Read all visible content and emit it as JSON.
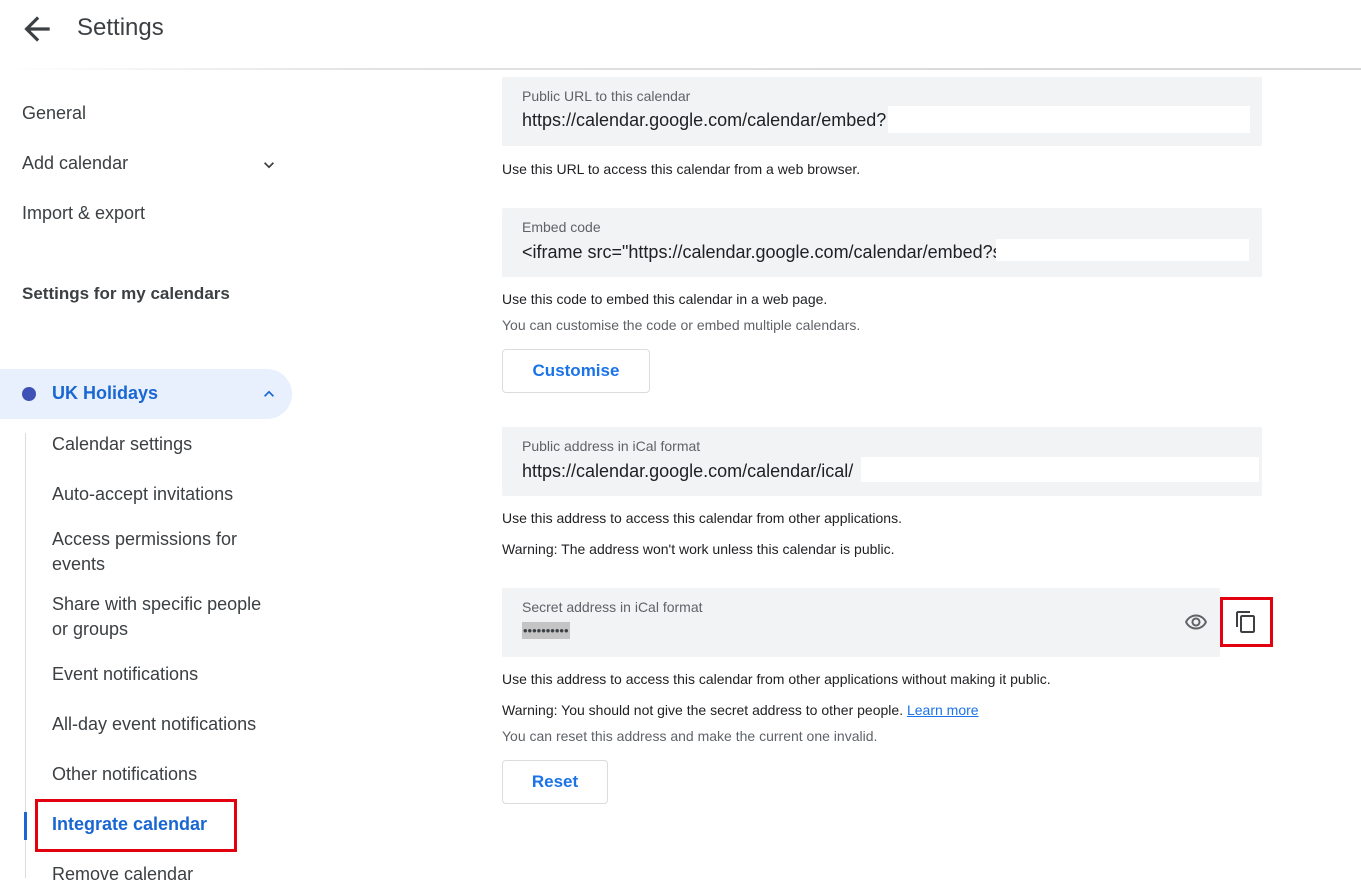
{
  "header": {
    "title": "Settings",
    "back_icon": "arrow-back-icon"
  },
  "sidebar": {
    "items": [
      {
        "label": "General"
      },
      {
        "label": "Add calendar"
      },
      {
        "label": "Import & export"
      }
    ],
    "section_title": "Settings for my calendars",
    "calendar": {
      "name": "UK Holidays",
      "color": "#3f51b5",
      "sub_items": [
        {
          "label": "Calendar settings"
        },
        {
          "label": "Auto-accept invitations"
        },
        {
          "label": "Access permissions for events"
        },
        {
          "label": "Share with specific people or groups"
        },
        {
          "label": "Event notifications"
        },
        {
          "label": "All-day event notifications"
        },
        {
          "label": "Other notifications"
        },
        {
          "label": "Integrate calendar"
        },
        {
          "label": "Remove calendar"
        }
      ]
    }
  },
  "main": {
    "public_url": {
      "label": "Public URL to this calendar",
      "value": "https://calendar.google.com/calendar/embed?",
      "helper": "Use this URL to access this calendar from a web browser."
    },
    "embed_code": {
      "label": "Embed code",
      "value": "<iframe src=\"https://calendar.google.com/calendar/embed?s",
      "helper": "Use this code to embed this calendar in a web page.",
      "helper2": "You can customise the code or embed multiple calendars.",
      "button": "Customise"
    },
    "ical_public": {
      "label": "Public address in iCal format",
      "value": "https://calendar.google.com/calendar/ical/",
      "helper": "Use this address to access this calendar from other applications.",
      "warning": "Warning: The address won't work unless this calendar is public."
    },
    "ical_secret": {
      "label": "Secret address in iCal format",
      "value": "••••••••••",
      "helper": "Use this address to access this calendar from other applications without making it public.",
      "warning": "Warning: You should not give the secret address to other people.",
      "learn_more": "Learn more",
      "reset_note": "You can reset this address and make the current one invalid.",
      "button": "Reset"
    }
  },
  "colors": {
    "accent": "#1a73e8",
    "active_text": "#1967d2",
    "highlight": "#e3000f"
  }
}
